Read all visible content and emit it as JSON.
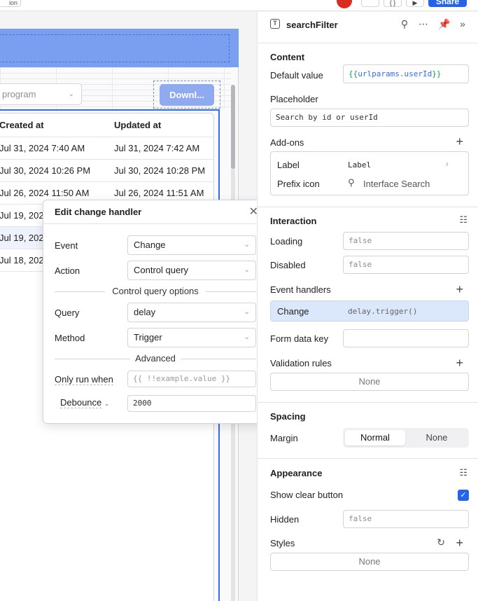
{
  "topbar": {
    "left_btn": "ion",
    "share_label": "Share",
    "btn1": "",
    "btn2": "{ }",
    "btn3": "▶"
  },
  "canvas": {
    "select_placeholder": "program",
    "download_label": "Downl...",
    "table": {
      "headers": [
        "Created at",
        "Updated at"
      ],
      "rows": [
        [
          "Jul 31, 2024 7:40 AM",
          "Jul 31, 2024 7:42 AM"
        ],
        [
          "Jul 30, 2024 10:26 PM",
          "Jul 30, 2024 10:28 PM"
        ],
        [
          "Jul 26, 2024 11:50 AM",
          "Jul 26, 2024 11:51 AM"
        ],
        [
          "Jul 19, 202",
          ""
        ],
        [
          "Jul 19, 202",
          ""
        ],
        [
          "Jul 18, 202",
          ""
        ]
      ]
    }
  },
  "popup": {
    "title": "Edit change handler",
    "event_label": "Event",
    "event_value": "Change",
    "action_label": "Action",
    "action_value": "Control query",
    "section_options": "Control query options",
    "query_label": "Query",
    "query_value": "delay",
    "method_label": "Method",
    "method_value": "Trigger",
    "section_advanced": "Advanced",
    "only_run_label": "Only run when",
    "only_run_placeholder": "{{ !!example.value }}",
    "debounce_label": "Debounce",
    "debounce_value": "2000"
  },
  "inspector": {
    "component_name": "searchFilter",
    "content": {
      "title": "Content",
      "default_value_label": "Default value",
      "default_value_prefix": "{{",
      "default_value_code": "urlparams.userId",
      "default_value_suffix": "}}",
      "placeholder_label": "Placeholder",
      "placeholder_value": "Search by id or userId",
      "addons_label": "Add-ons",
      "addon_label_key": "Label",
      "addon_label_value": "Label",
      "addon_prefix_key": "Prefix icon",
      "addon_prefix_value": "Interface Search"
    },
    "interaction": {
      "title": "Interaction",
      "loading_label": "Loading",
      "loading_value": "false",
      "disabled_label": "Disabled",
      "disabled_value": "false",
      "event_handlers_label": "Event handlers",
      "handler_event": "Change",
      "handler_action": "delay.trigger()",
      "form_data_key_label": "Form data key",
      "form_data_key_value": "",
      "validation_label": "Validation rules",
      "validation_value": "None"
    },
    "spacing": {
      "title": "Spacing",
      "margin_label": "Margin",
      "margin_options": [
        "Normal",
        "None"
      ]
    },
    "appearance": {
      "title": "Appearance",
      "show_clear_label": "Show clear button",
      "show_clear_checked": true,
      "hidden_label": "Hidden",
      "hidden_value": "false",
      "styles_label": "Styles",
      "styles_value": "None"
    }
  },
  "colors": {
    "accent": "#2563eb",
    "header_band": "#7b9ff0",
    "handler_row": "#dbe7fb"
  }
}
